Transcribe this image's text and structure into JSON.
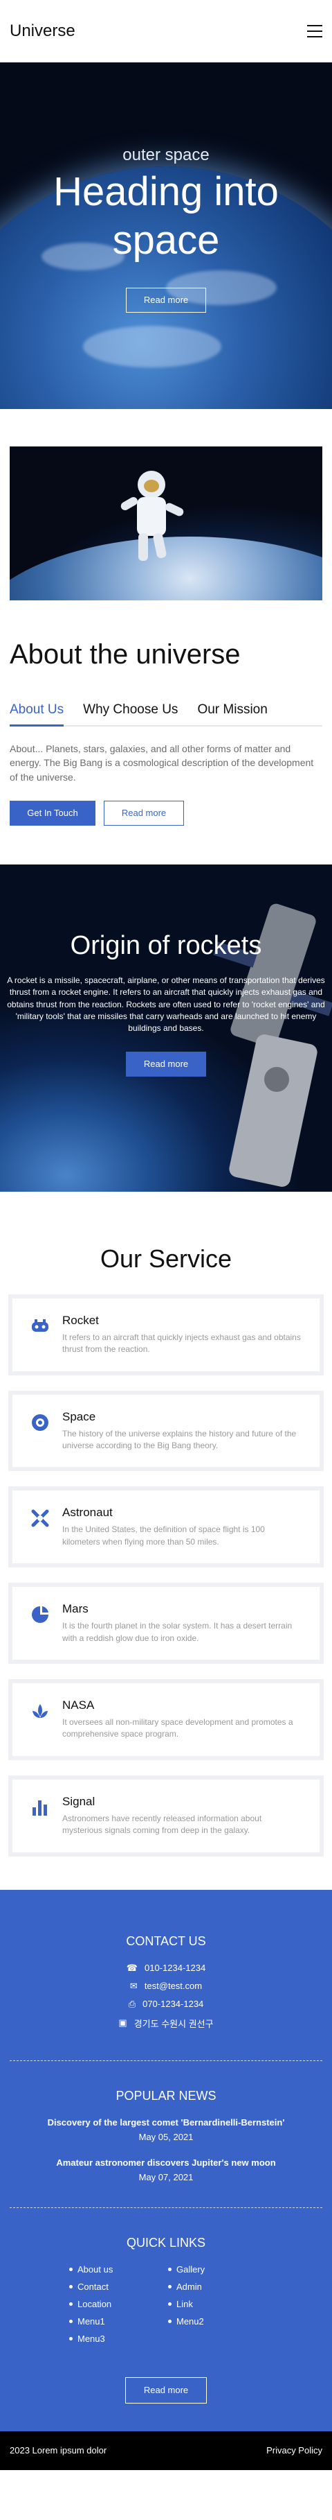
{
  "header": {
    "logo": "Universe"
  },
  "hero": {
    "subtitle": "outer space",
    "title": "Heading into space",
    "button": "Read more"
  },
  "about": {
    "title": "About the universe",
    "tabs": [
      "About Us",
      "Why Choose Us",
      "Our Mission"
    ],
    "text": "About... Planets, stars, galaxies, and all other forms of matter and energy. The Big Bang is a cosmological description of the development of the universe.",
    "primary_button": "Get In Touch",
    "secondary_button": "Read more"
  },
  "rockets": {
    "title": "Origin of rockets",
    "text": "A rocket is a missile, spacecraft, airplane, or other means of transportation that derives thrust from a rocket engine. It refers to an aircraft that quickly injects exhaust gas and obtains thrust from the reaction. Rockets are often used to refer to 'rocket engines' and 'military tools' that are missiles that carry warheads and are launched to hit enemy buildings and bases.",
    "button": "Read more"
  },
  "services": {
    "title": "Our Service",
    "items": [
      {
        "title": "Rocket",
        "desc": "It refers to an aircraft that quickly injects exhaust gas and obtains thrust from the reaction.",
        "icon": "rocket-icon"
      },
      {
        "title": "Space",
        "desc": "The history of the universe explains the history and future of the universe according to the Big Bang theory.",
        "icon": "globe-icon"
      },
      {
        "title": "Astronaut",
        "desc": "In the United States, the definition of space flight is 100 kilometers when flying more than 50 miles.",
        "icon": "astronaut-icon"
      },
      {
        "title": "Mars",
        "desc": "It is the fourth planet in the solar system. It has a desert terrain with a reddish glow due to iron oxide.",
        "icon": "planet-icon"
      },
      {
        "title": "NASA",
        "desc": "It oversees all non-military space development and promotes a comprehensive space program.",
        "icon": "nasa-icon"
      },
      {
        "title": "Signal",
        "desc": "Astronomers have recently released information about mysterious signals coming from deep in the galaxy.",
        "icon": "signal-icon"
      }
    ],
    "accent": "#3a63c8"
  },
  "footer": {
    "contact_title": "CONTACT US",
    "phone": "010-1234-1234",
    "email": "test@test.com",
    "fax": "070-1234-1234",
    "address": "경기도 수원시 권선구",
    "news_title": "POPULAR NEWS",
    "news": [
      {
        "title": "Discovery of the largest comet 'Bernardinelli-Bernstein'",
        "date": "May 05, 2021"
      },
      {
        "title": "Amateur astronomer discovers Jupiter's new moon",
        "date": "May 07, 2021"
      }
    ],
    "links_title": "QUICK LINKS",
    "links_left": [
      "About us",
      "Contact",
      "Location",
      "Menu1",
      "Menu3"
    ],
    "links_right": [
      "Gallery",
      "Admin",
      "Link",
      "Menu2"
    ],
    "button": "Read more",
    "background": "#3a63c8"
  },
  "bottom": {
    "copyright": "2023 Lorem ipsum dolor",
    "policy": "Privacy Policy"
  }
}
